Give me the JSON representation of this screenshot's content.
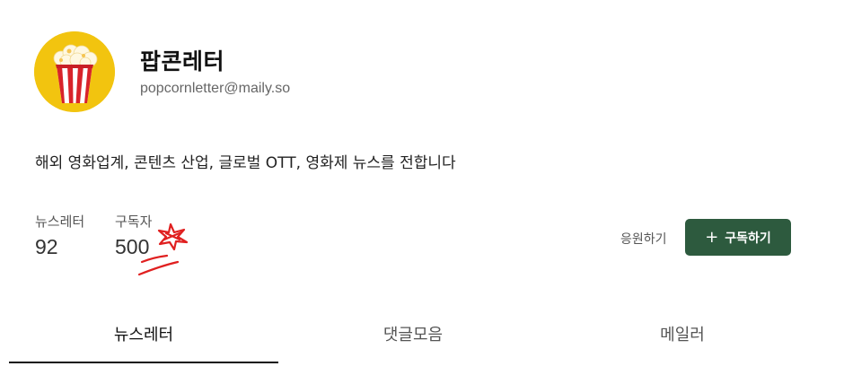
{
  "profile": {
    "name": "팝콘레터",
    "email": "popcornletter@maily.so",
    "avatar_icon": "popcorn-icon",
    "avatar_color": "#f2c40f",
    "description": "해외 영화업계, 콘텐츠 산업, 글로벌 OTT, 영화제 뉴스를 전합니다"
  },
  "stats": {
    "newsletters_label": "뉴스레터",
    "newsletters_count": "92",
    "subscribers_label": "구독자",
    "subscribers_count": "500"
  },
  "actions": {
    "support_label": "응원하기",
    "subscribe_label": "구독하기",
    "subscribe_icon": "plus-icon",
    "subscribe_color": "#2d5a3e"
  },
  "tabs": [
    {
      "label": "뉴스레터",
      "active": true
    },
    {
      "label": "댓글모음",
      "active": false
    },
    {
      "label": "메일러",
      "active": false
    }
  ],
  "annotation": {
    "color": "#e02020",
    "marks": [
      "star-doodle-icon",
      "underline-doodle"
    ]
  }
}
